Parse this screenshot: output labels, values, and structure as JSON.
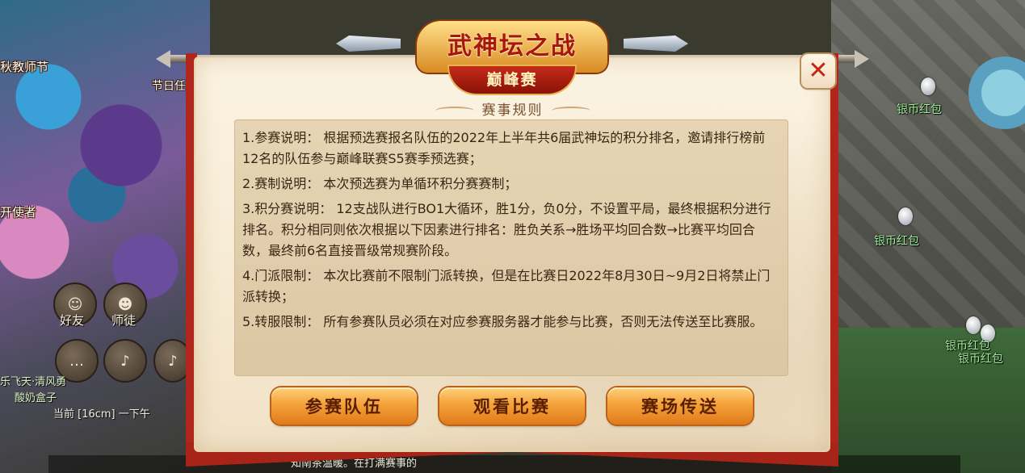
{
  "background": {
    "npc_labels": [
      "秋教师节",
      "节日任",
      "开使者",
      "好友",
      "师徒"
    ],
    "silver_labels": [
      "银币红包",
      "银币红包",
      "银币红包",
      "银币红包"
    ],
    "chat_lines": [
      "乐飞天·清风勇",
      "酸奶盒子",
      "当前 [16cm] 一下午",
      "知南茶温暖。在打满赛事的"
    ]
  },
  "dialog": {
    "title": "武神坛之战",
    "subtitle": "巅峰赛",
    "section_title": "赛事规则",
    "close_label": "✕",
    "rules": [
      "1.参赛说明： 根据预选赛报名队伍的2022年上半年共6届武神坛的积分排名，邀请排行榜前12名的队伍参与巅峰联赛S5赛季预选赛；",
      "2.赛制说明： 本次预选赛为单循环积分赛赛制；",
      "3.积分赛说明： 12支战队进行BO1大循环，胜1分，负0分，不设置平局，最终根据积分进行排名。积分相同则依次根据以下因素进行排名：胜负关系→胜场平均回合数→比赛平均回合数，最终前6名直接晋级常规赛阶段。",
      "4.门派限制： 本次比赛前不限制门派转换，但是在比赛日2022年8月30日~9月2日将禁止门派转换；",
      "5.转服限制： 所有参赛队员必须在对应参赛服务器才能参与比赛，否则无法传送至比赛服。"
    ],
    "buttons": {
      "teams": "参赛队伍",
      "watch": "观看比赛",
      "teleport": "赛场传送"
    }
  }
}
